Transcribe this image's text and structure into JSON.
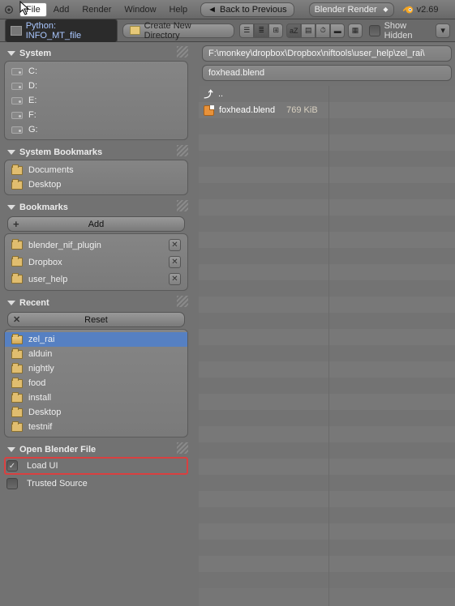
{
  "topmenu": {
    "file": "File",
    "add": "Add",
    "render": "Render",
    "window": "Window",
    "help": "Help",
    "back": "Back to Previous",
    "engine": "Blender Render",
    "version": "v2.69"
  },
  "second": {
    "python": "Python: INFO_MT_file",
    "create_dir": "Create New Directory",
    "show_hidden": "Show Hidden"
  },
  "path": "F:\\monkey\\dropbox\\Dropbox\\niftools\\user_help\\zel_rai\\",
  "filename": "foxhead.blend",
  "sidebar": {
    "system": {
      "title": "System",
      "drives": [
        "C:",
        "D:",
        "E:",
        "F:",
        "G:"
      ]
    },
    "sys_bm": {
      "title": "System Bookmarks",
      "items": [
        "Documents",
        "Desktop"
      ]
    },
    "bookmarks": {
      "title": "Bookmarks",
      "add": "Add",
      "items": [
        "blender_nif_plugin",
        "Dropbox",
        "user_help"
      ]
    },
    "recent": {
      "title": "Recent",
      "reset": "Reset",
      "items": [
        "zel_rai",
        "alduin",
        "nightly",
        "food",
        "install",
        "Desktop",
        "testnif"
      ],
      "selected": 0
    },
    "open": {
      "title": "Open Blender File",
      "load_ui": "Load UI",
      "trusted": "Trusted Source"
    }
  },
  "files": {
    "updir": "..",
    "entries": [
      {
        "name": "foxhead.blend",
        "size": "769 KiB"
      }
    ]
  }
}
